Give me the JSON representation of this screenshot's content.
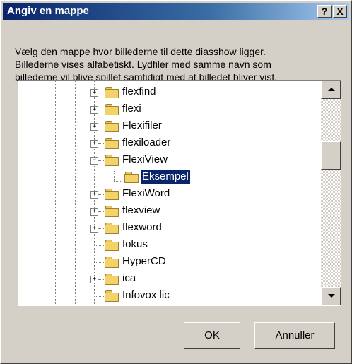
{
  "window": {
    "title": "Angiv en mappe",
    "help_button": "?",
    "close_button": "X"
  },
  "description": {
    "line1": "Vælg den mappe hvor billederne til dette diasshow ligger.",
    "line2": "Billederne vises alfabetiskt. Lydfiler med samme navn som",
    "line3": "billederne vil blive spillet samtidigt med at billedet bliver vist."
  },
  "tree": {
    "items": [
      {
        "label": "flexfind",
        "expander": "+"
      },
      {
        "label": "flexi",
        "expander": "+"
      },
      {
        "label": "Flexifiler",
        "expander": "+"
      },
      {
        "label": "flexiloader",
        "expander": "+"
      },
      {
        "label": "FlexiView",
        "expander": "−"
      },
      {
        "label": "Eksempel",
        "expander": "",
        "selected": true
      },
      {
        "label": "FlexiWord",
        "expander": "+"
      },
      {
        "label": "flexview",
        "expander": "+"
      },
      {
        "label": "flexword",
        "expander": "+"
      },
      {
        "label": "fokus",
        "expander": ""
      },
      {
        "label": "HyperCD",
        "expander": ""
      },
      {
        "label": "ica",
        "expander": "+"
      },
      {
        "label": "Infovox lic",
        "expander": ""
      }
    ]
  },
  "buttons": {
    "ok": "OK",
    "cancel": "Annuller"
  },
  "colors": {
    "title_start": "#0a246a",
    "title_end": "#a6caf0",
    "selection": "#0a246a",
    "dialog_bg": "#d4d0c8",
    "folder": "#f4d26a"
  }
}
